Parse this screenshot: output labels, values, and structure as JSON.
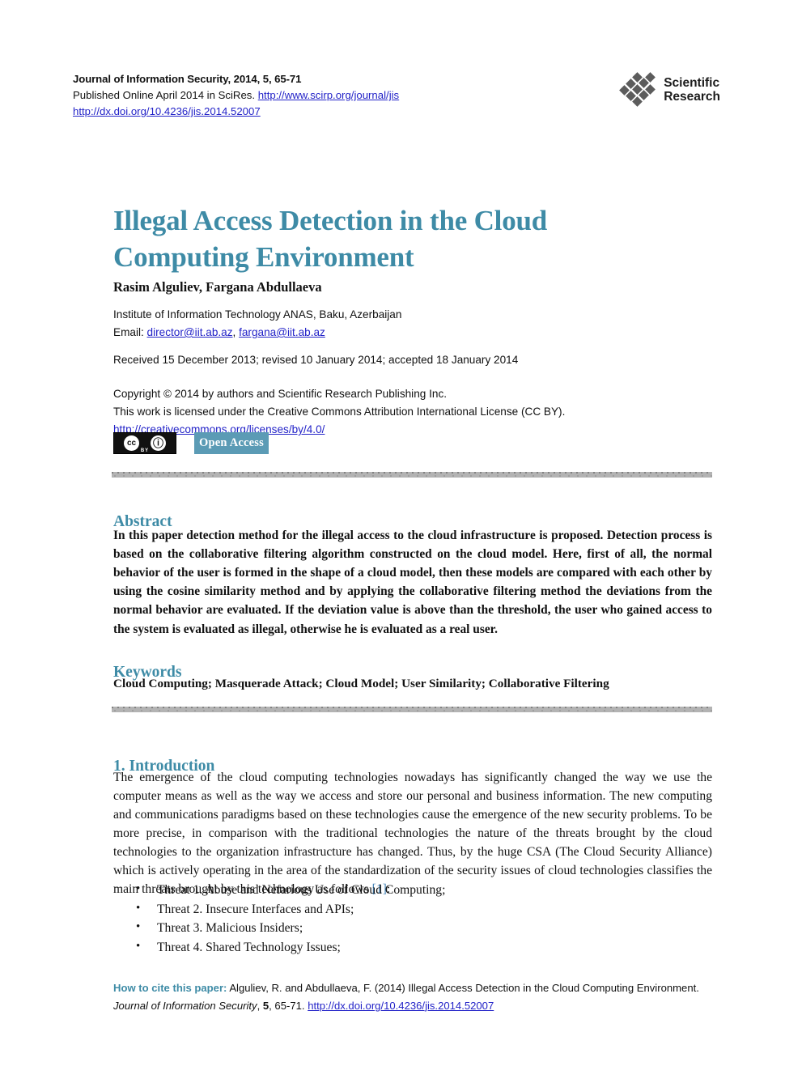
{
  "masthead": {
    "journal_line": "Journal of Information Security, 2014, 5, 65-71",
    "published_prefix": "Published Online April 2014 in SciRes. ",
    "scirp_url": "http://www.scirp.org/journal/jis",
    "doi_url": "http://dx.doi.org/10.4236/jis.2014.52007",
    "logo_line1": "Scientific",
    "logo_line2": "Research"
  },
  "title": "Illegal Access Detection in the Cloud Computing Environment",
  "authors": "Rasim Alguliev, Fargana Abdullaeva",
  "affiliation": "Institute of Information Technology ANAS, Baku, Azerbaijan",
  "email_label": "Email: ",
  "email1": "director@iit.ab.az",
  "email_sep": ", ",
  "email2": "fargana@iit.ab.az",
  "dates": "Received 15 December 2013; revised 10 January 2014; accepted 18 January 2014",
  "copyright": {
    "line1": "Copyright © 2014 by authors and Scientific Research Publishing Inc.",
    "line2": "This work is licensed under the Creative Commons Attribution International License (CC BY).",
    "license_url": "http://creativecommons.org/licenses/by/4.0/"
  },
  "badges": {
    "cc_mark": "cc",
    "cc_info": "ⓘ",
    "cc_by": "BY",
    "open_access": "Open Access"
  },
  "sections": {
    "abstract_heading": "Abstract",
    "abstract_text": "In this paper detection method for the illegal access to the cloud infrastructure is proposed. Detection process is based on the collaborative filtering algorithm constructed on the cloud model. Here, first of all, the normal behavior of the user is formed in the shape of a cloud model, then these models are compared with each other by using the cosine similarity method and by applying the collaborative filtering method the deviations from the normal behavior are evaluated. If the deviation value is above than the threshold, the user who gained access to the system is evaluated as illegal, otherwise he is evaluated as a real user.",
    "keywords_heading": "Keywords",
    "keywords_text": "Cloud Computing; Masquerade Attack; Cloud Model; User Similarity; Collaborative Filtering",
    "intro_heading": "1. Introduction",
    "intro_text_before_cite": "The emergence of the cloud computing technologies nowadays has significantly changed the way we use the computer means as well as the way we access and store our personal and business information. The new computing and communications paradigms based on these technologies cause the emergence of the new security problems. To be more precise, in comparison with the traditional technologies the nature of the threats brought by the cloud technologies to the organization infrastructure has changed. Thus, by the huge CSA (The Cloud Security Alliance) which is actively operating in the area of the standardization of the security issues of cloud technologies classifies the main threats brought by this technology as follows ",
    "intro_citation": "[1]",
    "intro_text_after_cite": ":",
    "threats": [
      "Threat 1. Abuse and Nefarious Use of Cloud Computing;",
      "Threat 2. Insecure Interfaces and APIs;",
      "Threat 3. Malicious Insiders;",
      "Threat 4. Shared Technology Issues;"
    ]
  },
  "footer": {
    "howto_label": "How to cite this paper:",
    "citation_text": " Alguliev, R. and Abdullaeva, F. (2014) Illegal Access Detection in the Cloud Computing Environment. ",
    "journal_name": "Journal of Information Security",
    "volume_sep": ", ",
    "volume": "5",
    "pages": ", 65-71. ",
    "doi_url": "http://dx.doi.org/10.4236/jis.2014.52007"
  },
  "colors": {
    "accent_teal": "#3e8ba6",
    "link_blue": "#2323c8",
    "citation_blue": "#4a86b8",
    "open_access_bg": "#5b9bb5"
  }
}
